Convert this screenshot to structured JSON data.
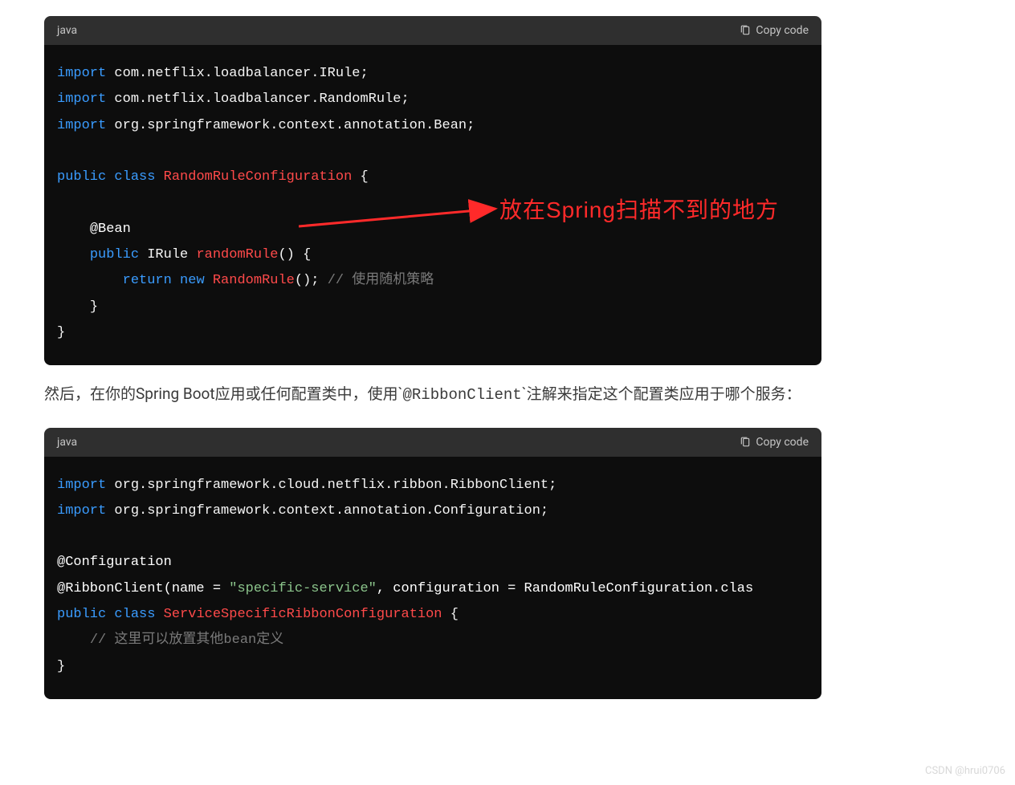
{
  "block1": {
    "lang": "java",
    "copy_label": "Copy code",
    "import_kw": "import",
    "import1_pkg": "com.netflix.loadbalancer.IRule;",
    "import2_pkg": "com.netflix.loadbalancer.RandomRule;",
    "import3_pkg": "org.springframework.context.annotation.Bean;",
    "public_kw": "public",
    "class_kw": "class",
    "class_name": "RandomRuleConfiguration",
    "brace_open": "{",
    "brace_close": "}",
    "bean_annot": "@Bean",
    "ret_type": "IRule",
    "method_name": "randomRule",
    "parens": "()",
    "return_kw": "return",
    "new_kw": "new",
    "ctor_name": "RandomRule",
    "semi": ";",
    "comment1": "// 使用随机策略"
  },
  "para": {
    "pre": "然后，在你的Spring Boot应用或任何配置类中，使用`",
    "code": "@RibbonClient",
    "post": "`注解来指定这个配置类应用于哪个服务："
  },
  "block2": {
    "lang": "java",
    "copy_label": "Copy code",
    "import_kw": "import",
    "import1_pkg": "org.springframework.cloud.netflix.ribbon.RibbonClient;",
    "import2_pkg": "org.springframework.context.annotation.Configuration;",
    "config_annot": "@Configuration",
    "ribbon_annot": "@RibbonClient(name = ",
    "ribbon_str": "\"specific-service\"",
    "ribbon_mid": ", configuration = RandomRuleConfiguration.clas",
    "public_kw": "public",
    "class_kw": "class",
    "class_name": "ServiceSpecificRibbonConfiguration",
    "brace_open": "{",
    "brace_close": "}",
    "comment1": "// 这里可以放置其他bean定义"
  },
  "annotation": {
    "red_label": "放在Spring扫描不到的地方"
  },
  "watermark": "CSDN @hrui0706"
}
